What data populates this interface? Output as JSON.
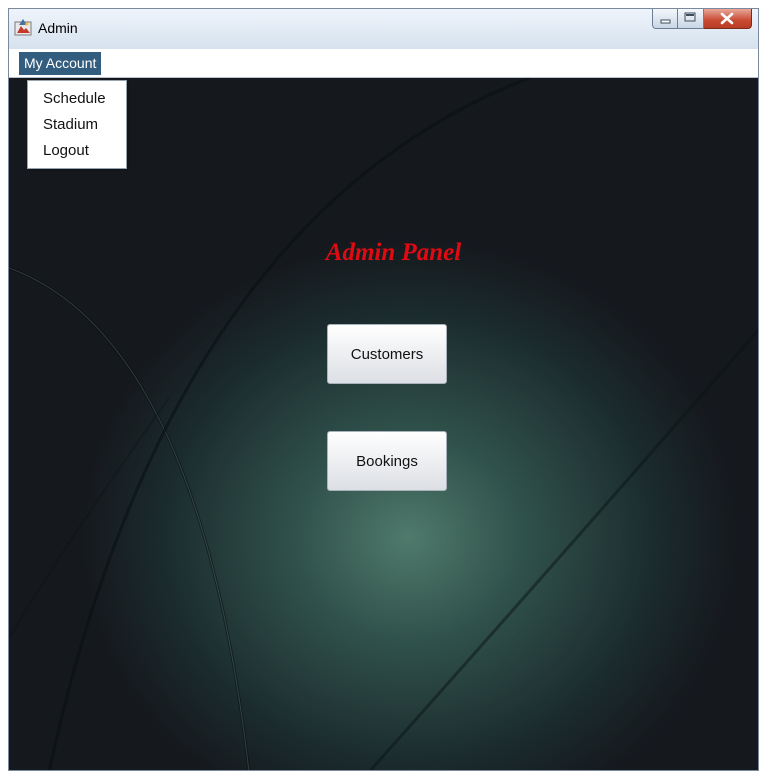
{
  "window": {
    "title": "Admin"
  },
  "menubar": {
    "menu_title": "My Account",
    "items": [
      {
        "label": "Schedule"
      },
      {
        "label": "Stadium"
      },
      {
        "label": "Logout"
      }
    ]
  },
  "main": {
    "heading": "Admin Panel",
    "buttons": [
      {
        "label": "Customers"
      },
      {
        "label": "Bookings"
      }
    ]
  },
  "icons": {
    "app": "admin-app-icon",
    "minimize": "minimize-icon",
    "maximize": "maximize-icon",
    "close": "close-icon"
  },
  "colors": {
    "heading": "#e00b12",
    "menu_selected": "#335d7f",
    "background_center": "#4f7a6c",
    "background_edge": "#15181d"
  }
}
